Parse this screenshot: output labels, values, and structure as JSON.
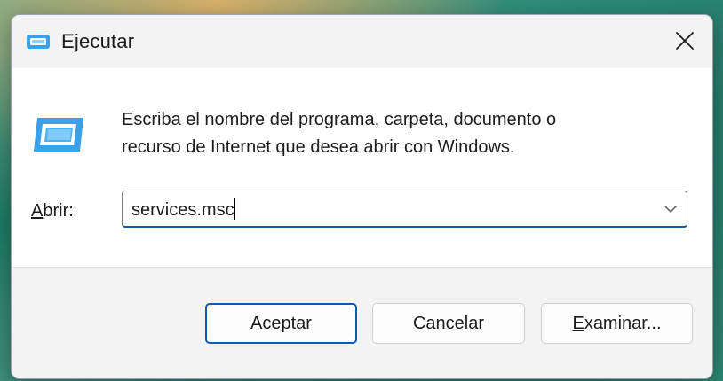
{
  "window": {
    "title": "Ejecutar",
    "close_label": "Cerrar"
  },
  "body": {
    "description_line1": "Escriba el nombre del programa, carpeta, documento o",
    "description_line2": "recurso de Internet que desea abrir con Windows.",
    "open_label_accel": "A",
    "open_label_rest": "brir:",
    "input_value": "services.msc"
  },
  "buttons": {
    "ok": "Aceptar",
    "cancel": "Cancelar",
    "browse_accel": "E",
    "browse_rest": "xaminar..."
  },
  "icons": {
    "title": "run-icon",
    "main": "run-icon",
    "close": "close-icon",
    "dropdown": "chevron-down-icon"
  },
  "colors": {
    "accent": "#0b5cad",
    "icon_blue": "#3aa0e8"
  }
}
